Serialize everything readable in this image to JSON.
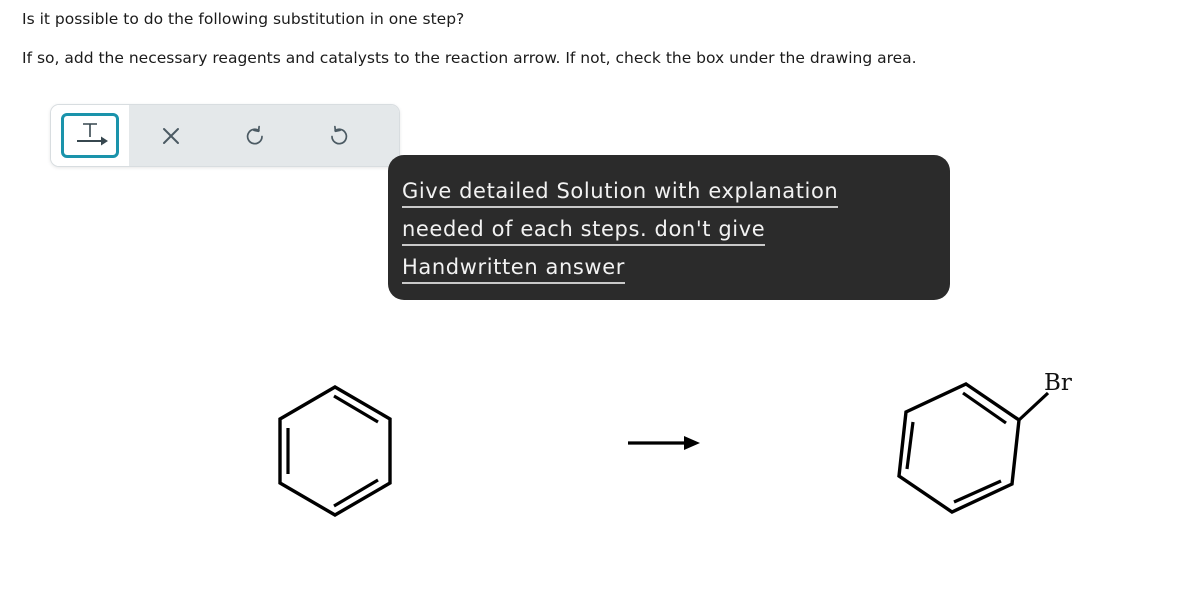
{
  "question": {
    "line1": "Is it possible to do the following substitution in one step?",
    "line2": "If so, add the necessary reagents and catalysts to the reaction arrow. If not, check the box under the drawing area."
  },
  "toolbar": {
    "tools": [
      {
        "name": "reaction-arrow-text-tool",
        "icon": "text-over-arrow-icon",
        "label": "T",
        "selected": true
      },
      {
        "name": "clear-tool",
        "icon": "close-x-icon",
        "label": "✕",
        "selected": false
      },
      {
        "name": "undo-tool",
        "icon": "undo-arrow-icon",
        "label": "↺",
        "selected": false
      },
      {
        "name": "redo-tool",
        "icon": "redo-arrow-icon",
        "label": "↻",
        "selected": false
      }
    ],
    "selected_color": "#1a93ab",
    "strip_color": "#e4e8ea",
    "icon_color": "#4b5a63"
  },
  "overlay_note": {
    "lines": [
      "Give detailed Solution with explanation",
      "needed of each steps. don't give",
      "Handwritten answer"
    ],
    "background": "#2b2b2b",
    "text_color": "#f2f2f2"
  },
  "reaction": {
    "reactant": {
      "name": "benzene",
      "label": ""
    },
    "arrow": {
      "name": "reaction-arrow",
      "reagents_above": "",
      "reagents_below": ""
    },
    "product": {
      "name": "bromobenzene",
      "substituent_label": "Br"
    },
    "bond_color": "#000000"
  }
}
